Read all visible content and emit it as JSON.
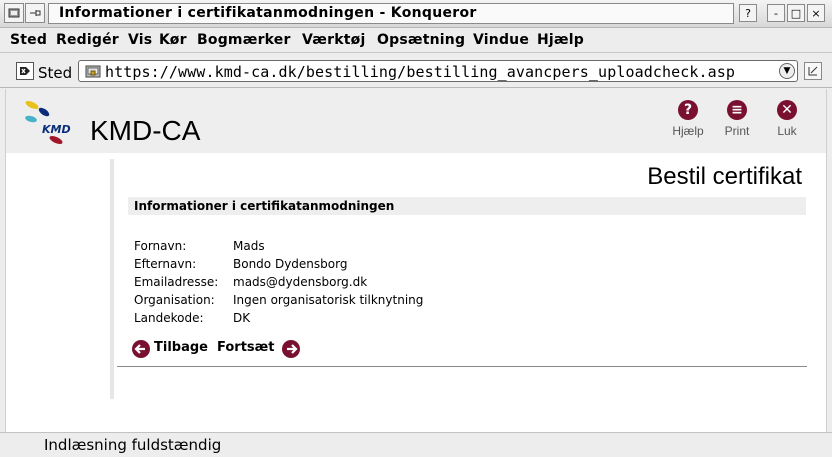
{
  "window": {
    "title": "Informationer i certifikatanmodningen  - Konqueror",
    "buttons": {
      "help": "?",
      "minimize": "-",
      "maximize": "□",
      "close": "×"
    }
  },
  "menubar": {
    "items": [
      "Sted",
      "Redigér",
      "Vis",
      "Kør",
      "Bogmærker",
      "Værktøj",
      "Opsætning",
      "Vindue",
      "Hjælp"
    ]
  },
  "location": {
    "label": "Sted",
    "url": "https://www.kmd-ca.dk/bestilling/bestilling_avancpers_uploadcheck.asp"
  },
  "header": {
    "brand": "KMD-CA",
    "logo_text": "KMD",
    "actions": [
      {
        "label": "Hjælp",
        "glyph": "?"
      },
      {
        "label": "Print",
        "glyph": "≡"
      },
      {
        "label": "Luk",
        "glyph": "✕"
      }
    ]
  },
  "page": {
    "title": "Bestil certifikat",
    "section_title": "Informationer i certifikatanmodningen",
    "fields": [
      {
        "label": "Fornavn:",
        "value": "Mads"
      },
      {
        "label": "Efternavn:",
        "value": "Bondo Dydensborg"
      },
      {
        "label": "Emailadresse:",
        "value": "mads@dydensborg.dk"
      },
      {
        "label": "Organisation:",
        "value": "Ingen organisatorisk tilknytning"
      },
      {
        "label": "Landekode:",
        "value": "DK"
      }
    ],
    "back_label": "Tilbage",
    "continue_label": "Fortsæt"
  },
  "status": {
    "text": "Indlæsning fuldstændig"
  },
  "colors": {
    "accent": "#7a1030"
  }
}
